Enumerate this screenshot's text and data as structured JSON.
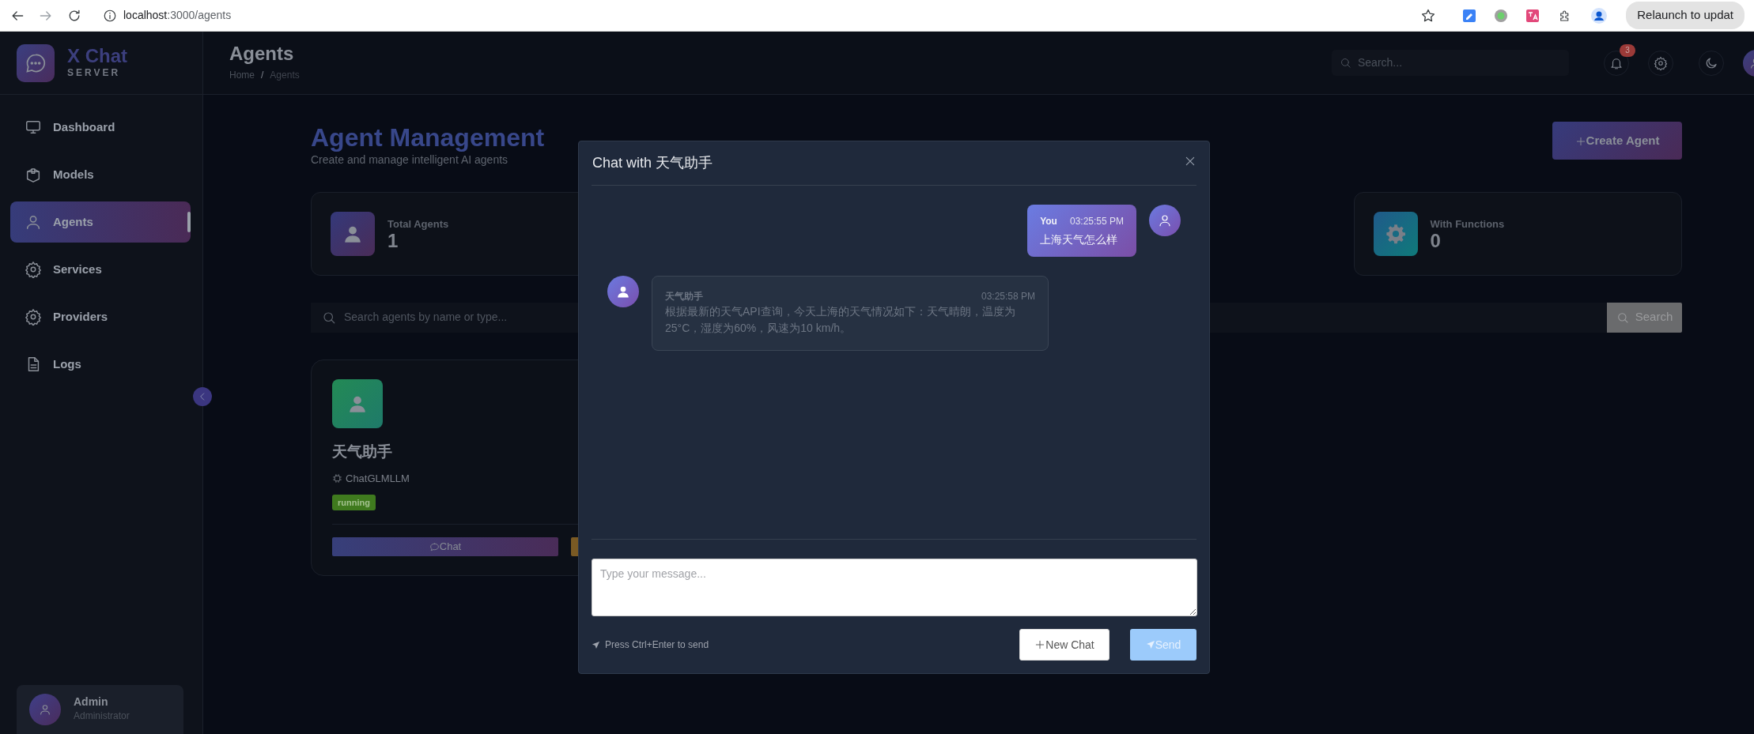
{
  "browser": {
    "host": "localhost",
    "path": ":3000/agents",
    "relaunch": "Relaunch to updat"
  },
  "sidebar": {
    "brand": "X Chat",
    "brand_sub": "SERVER",
    "items": [
      {
        "label": "Dashboard",
        "kind": "monitor",
        "selected": false
      },
      {
        "label": "Models",
        "kind": "box",
        "selected": false
      },
      {
        "label": "Agents",
        "kind": "person",
        "selected": true
      },
      {
        "label": "Services",
        "kind": "gear",
        "selected": false
      },
      {
        "label": "Providers",
        "kind": "gear",
        "selected": false
      },
      {
        "label": "Logs",
        "kind": "file",
        "selected": false
      }
    ],
    "user": {
      "name": "Admin",
      "role": "Administrator"
    }
  },
  "header": {
    "title": "Agents",
    "breadcrumb": [
      "Home",
      "Agents"
    ],
    "breadcrumb_separator": "/",
    "search_placeholder": "Search...",
    "notification_count": "3"
  },
  "page": {
    "title": "Agent Management",
    "subtitle": "Create and manage intelligent AI agents",
    "create_button": "Create Agent",
    "stats": [
      {
        "label": "Total Agents",
        "value": "1",
        "kind": "agents"
      },
      {
        "label": "With Functions",
        "value": "0",
        "kind": "functions"
      }
    ],
    "search": {
      "placeholder": "Search agents by name or type...",
      "button": "Search"
    },
    "agents": [
      {
        "name": "天气助手",
        "model": "ChatGLMLLM",
        "status": "running",
        "chat_button": "Chat"
      }
    ]
  },
  "modal": {
    "title": "Chat with 天气助手",
    "messages": [
      {
        "kind": "user",
        "sender": "You",
        "time": "03:25:55 PM",
        "text": "上海天气怎么样"
      },
      {
        "kind": "agent",
        "sender": "天气助手",
        "time": "03:25:58 PM",
        "text": "根据最新的天气API查询，今天上海的天气情况如下：天气晴朗，温度为25°C，湿度为60%，风速为10 km/h。"
      }
    ],
    "input_placeholder": "Type your message...",
    "hint": "Press Ctrl+Enter to send",
    "new_chat_button": "New Chat",
    "send_button": "Send",
    "send_disabled": true
  }
}
